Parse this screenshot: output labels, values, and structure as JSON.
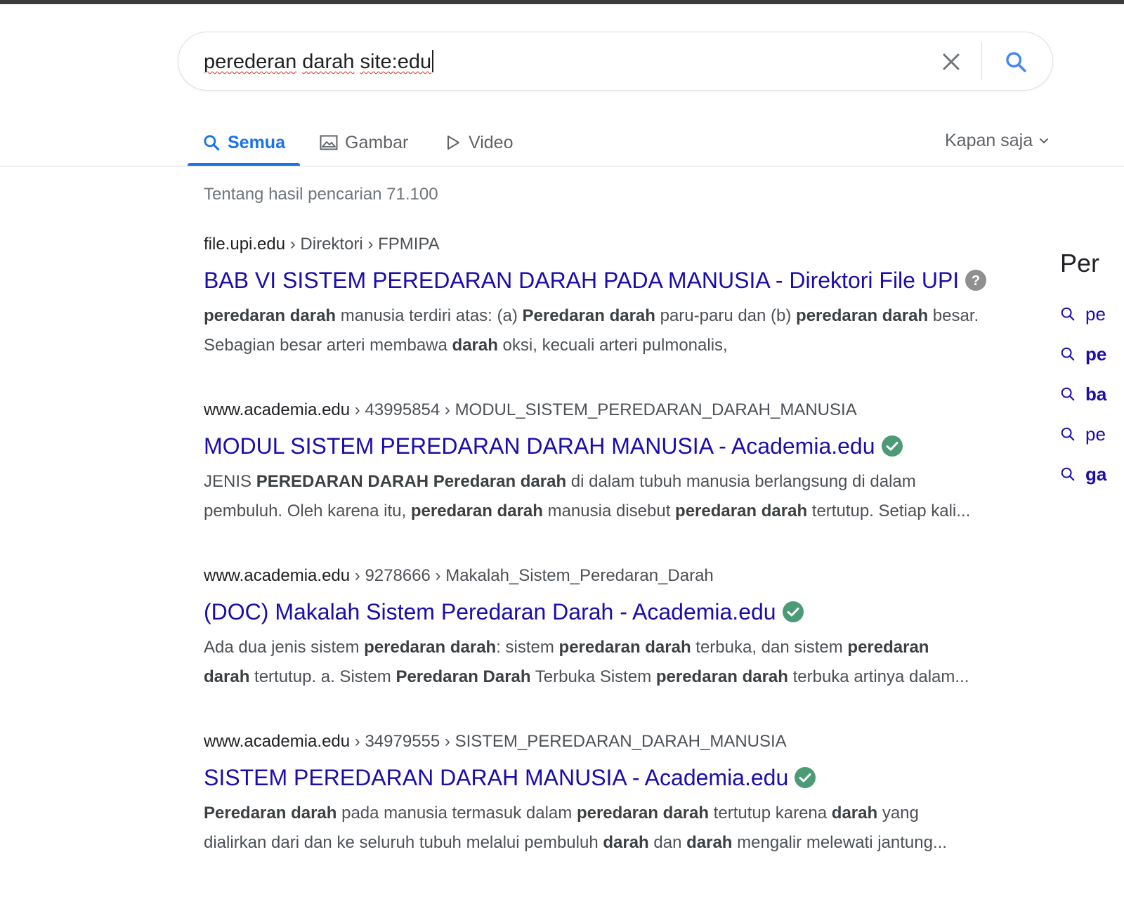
{
  "search": {
    "query_words": [
      "perederan",
      "darah",
      "site:edu"
    ],
    "clear_icon": "close-icon",
    "search_icon": "search-icon"
  },
  "tabs": [
    {
      "label": "Semua",
      "icon": "search-icon",
      "active": true
    },
    {
      "label": "Gambar",
      "icon": "image-icon",
      "active": false
    },
    {
      "label": "Video",
      "icon": "play-icon",
      "active": false
    }
  ],
  "time_filter": {
    "label": "Kapan saja",
    "icon": "chevron-down-icon"
  },
  "result_stats": "Tentang hasil pencarian 71.100",
  "results": [
    {
      "site": "file.upi.edu",
      "path": " › Direktori › FPMIPA",
      "title": "BAB VI SISTEM PEREDARAN DARAH PADA MANUSIA - Direktori File UPI",
      "badge": "help-icon",
      "snippet_lines": [
        [
          {
            "b": true,
            "t": "peredaran darah"
          },
          {
            "b": false,
            "t": " manusia terdiri atas: (a) "
          },
          {
            "b": true,
            "t": "Peredaran darah"
          },
          {
            "b": false,
            "t": " paru-paru dan (b) "
          },
          {
            "b": true,
            "t": "peredaran darah"
          },
          {
            "b": false,
            "t": " besar."
          }
        ],
        [
          {
            "b": false,
            "t": "Sebagian besar arteri membawa "
          },
          {
            "b": true,
            "t": "darah"
          },
          {
            "b": false,
            "t": " oksi, kecuali arteri pulmonalis,"
          }
        ]
      ]
    },
    {
      "site": "www.academia.edu",
      "path": " › 43995854 › MODUL_SISTEM_PEREDARAN_DARAH_MANUSIA",
      "title": "MODUL SISTEM PEREDARAN DARAH MANUSIA - Academia.edu",
      "badge": "verified-check-icon",
      "snippet_lines": [
        [
          {
            "b": false,
            "t": "JENIS "
          },
          {
            "b": true,
            "t": "PEREDARAN DARAH Peredaran darah"
          },
          {
            "b": false,
            "t": " di dalam tubuh manusia berlangsung di dalam"
          }
        ],
        [
          {
            "b": false,
            "t": "pembuluh. Oleh karena itu, "
          },
          {
            "b": true,
            "t": "peredaran darah"
          },
          {
            "b": false,
            "t": " manusia disebut "
          },
          {
            "b": true,
            "t": "peredaran darah"
          },
          {
            "b": false,
            "t": " tertutup. Setiap kali..."
          }
        ]
      ]
    },
    {
      "site": "www.academia.edu",
      "path": " › 9278666 › Makalah_Sistem_Peredaran_Darah",
      "title": "(DOC) Makalah Sistem Peredaran Darah - Academia.edu",
      "badge": "verified-check-icon",
      "snippet_lines": [
        [
          {
            "b": false,
            "t": "Ada dua jenis sistem "
          },
          {
            "b": true,
            "t": "peredaran darah"
          },
          {
            "b": false,
            "t": ": sistem "
          },
          {
            "b": true,
            "t": "peredaran darah"
          },
          {
            "b": false,
            "t": " terbuka, dan sistem "
          },
          {
            "b": true,
            "t": "peredaran"
          }
        ],
        [
          {
            "b": true,
            "t": "darah"
          },
          {
            "b": false,
            "t": " tertutup. a. Sistem "
          },
          {
            "b": true,
            "t": "Peredaran Darah"
          },
          {
            "b": false,
            "t": " Terbuka Sistem "
          },
          {
            "b": true,
            "t": "peredaran darah"
          },
          {
            "b": false,
            "t": " terbuka artinya dalam..."
          }
        ]
      ]
    },
    {
      "site": "www.academia.edu",
      "path": " › 34979555 › SISTEM_PEREDARAN_DARAH_MANUSIA",
      "title": "SISTEM PEREDARAN DARAH MANUSIA - Academia.edu",
      "badge": "verified-check-icon",
      "snippet_lines": [
        [
          {
            "b": true,
            "t": "Peredaran darah"
          },
          {
            "b": false,
            "t": " pada manusia termasuk dalam "
          },
          {
            "b": true,
            "t": "peredaran darah"
          },
          {
            "b": false,
            "t": " tertutup karena "
          },
          {
            "b": true,
            "t": "darah"
          },
          {
            "b": false,
            "t": " yang"
          }
        ],
        [
          {
            "b": false,
            "t": "dialirkan dari dan ke seluruh tubuh melalui pembuluh "
          },
          {
            "b": true,
            "t": "darah"
          },
          {
            "b": false,
            "t": " dan "
          },
          {
            "b": true,
            "t": "darah"
          },
          {
            "b": false,
            "t": " mengalir melewati jantung..."
          }
        ]
      ]
    }
  ],
  "sidebar": {
    "heading": "Per",
    "items": [
      {
        "label": "pe",
        "bold": false
      },
      {
        "label": "pe",
        "bold": true
      },
      {
        "label": "ba",
        "bold": true
      },
      {
        "label": "pe",
        "bold": false
      },
      {
        "label": "ga",
        "bold": true
      }
    ]
  },
  "colors": {
    "link": "#1a0dab",
    "accent": "#1a73e8",
    "verified": "#4c9a76",
    "help": "#909090"
  }
}
